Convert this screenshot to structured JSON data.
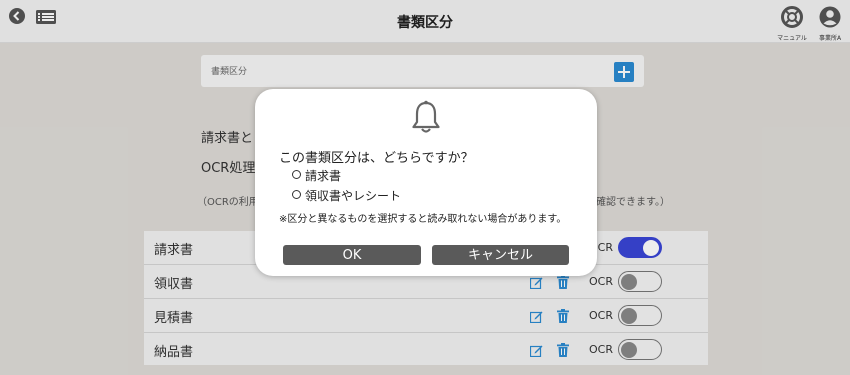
{
  "header": {
    "title": "書類区分",
    "manual_label": "マニュアル",
    "account_label": "事業所A"
  },
  "doc_input": {
    "placeholder": "書類区分"
  },
  "background_text": {
    "line1": "請求書と",
    "line2": "OCR処理",
    "note_left": "（OCRの利用",
    "note_right": "確認できます。）"
  },
  "categories": [
    {
      "name": "請求書",
      "ocr_label": "OCR",
      "ocr_on": true
    },
    {
      "name": "領収書",
      "ocr_label": "OCR",
      "ocr_on": false
    },
    {
      "name": "見積書",
      "ocr_label": "OCR",
      "ocr_on": false
    },
    {
      "name": "納品書",
      "ocr_label": "OCR",
      "ocr_on": false
    }
  ],
  "dialog": {
    "question": "この書類区分は、どちらですか？",
    "option1": "請求書",
    "option2": "領収書やレシート",
    "note": "※区分と異なるものを選択すると読み取れない場合があります。",
    "ok_label": "OK",
    "cancel_label": "キャンセル"
  },
  "colors": {
    "accent": "#2a8ad1",
    "toggle_on": "#3a45d6",
    "button": "#5a5a5a"
  },
  "icons": [
    "back-icon",
    "menu-icon",
    "manual-icon",
    "account-icon",
    "add-icon",
    "edit-icon",
    "trash-icon",
    "bell-icon"
  ]
}
